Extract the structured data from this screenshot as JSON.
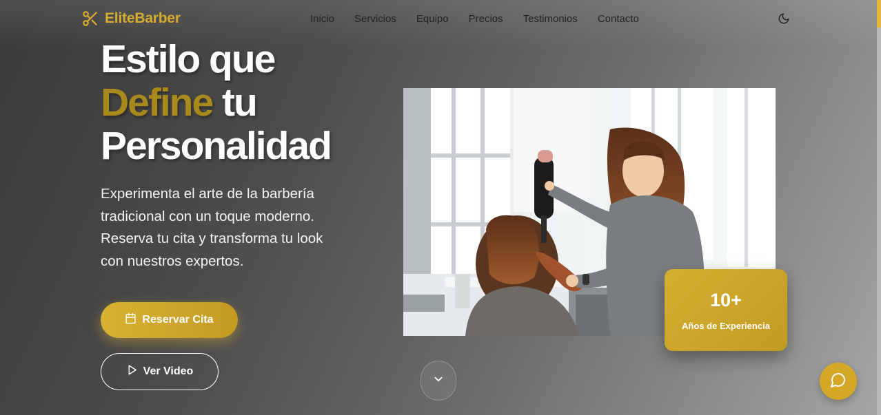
{
  "brand": {
    "name": "EliteBarber",
    "icon": "scissors-icon",
    "color": "#d8ac2e"
  },
  "nav": {
    "items": [
      "Inicio",
      "Servicios",
      "Equipo",
      "Precios",
      "Testimonios",
      "Contacto"
    ]
  },
  "theme_toggle": {
    "icon": "moon-icon"
  },
  "hero": {
    "line1": "Estilo que",
    "accent": "Define",
    "line2_rest": " tu",
    "line3": "Personalidad",
    "description": "Experimenta el arte de la barbería tradicional con un toque moderno. Reserva tu cita y transforma tu look con nuestros expertos.",
    "primary_button": {
      "label": "Reservar Cita",
      "icon": "calendar-icon"
    },
    "secondary_button": {
      "label": "Ver Video",
      "icon": "play-icon"
    }
  },
  "experience": {
    "value": "10+",
    "label": "Años de Experiencia"
  },
  "scroll_down": {
    "icon": "chevron-down-icon"
  },
  "chat": {
    "icon": "chat-bubble-icon"
  },
  "colors": {
    "accent": "#d5af31",
    "accent_dark": "#a8891b"
  }
}
